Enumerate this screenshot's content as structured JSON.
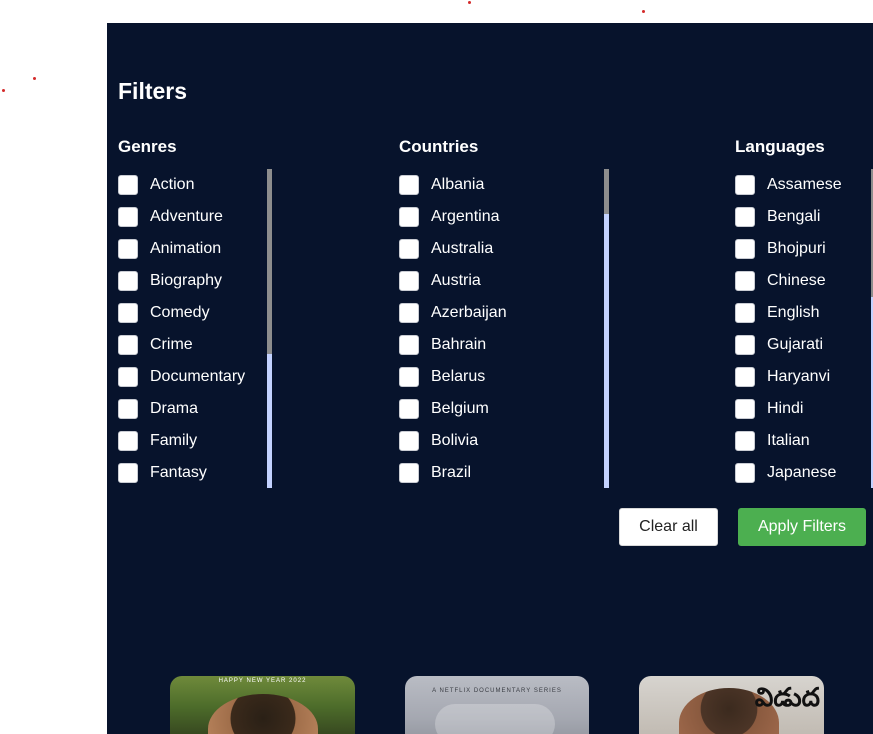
{
  "filters": {
    "title": "Filters",
    "groups": [
      {
        "title": "Genres",
        "options": [
          "Action",
          "Adventure",
          "Animation",
          "Biography",
          "Comedy",
          "Crime",
          "Documentary",
          "Drama",
          "Family",
          "Fantasy"
        ],
        "scroll_fraction": 0.58
      },
      {
        "title": "Countries",
        "options": [
          "Albania",
          "Argentina",
          "Australia",
          "Austria",
          "Azerbaijan",
          "Bahrain",
          "Belarus",
          "Belgium",
          "Bolivia",
          "Brazil"
        ],
        "scroll_fraction": 0.14
      },
      {
        "title": "Languages",
        "options": [
          "Assamese",
          "Bengali",
          "Bhojpuri",
          "Chinese",
          "English",
          "Gujarati",
          "Haryanvi",
          "Hindi",
          "Italian",
          "Japanese"
        ],
        "scroll_fraction": 0.4
      }
    ],
    "clear_label": "Clear all",
    "apply_label": "Apply Filters"
  },
  "posters": [
    {
      "text": "HAPPY NEW YEAR 2022"
    },
    {
      "text": "A NETFLIX DOCUMENTARY SERIES"
    },
    {
      "text": "విడుద"
    }
  ],
  "colors": {
    "panel_bg": "#07132c",
    "apply_button": "#4caf50",
    "scroll_track": "#c3d2ff",
    "scroll_thumb": "#8d8d8d"
  }
}
